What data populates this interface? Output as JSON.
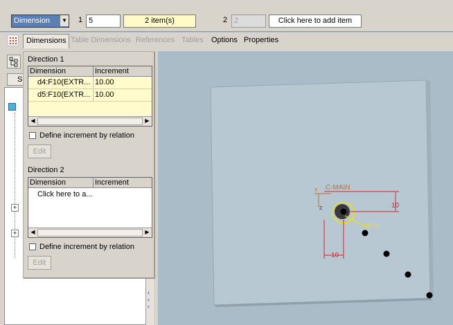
{
  "dashboard": {
    "dimension_select": "Dimension",
    "field1_label": "1",
    "field1_value": "5",
    "items_count": "2 item(s)",
    "field2_label": "2",
    "field2_value": "2",
    "add_item_prompt": "Click here to add item"
  },
  "tabs": [
    {
      "label": "Dimensions",
      "active": true,
      "enabled": true
    },
    {
      "label": "Table Dimensions",
      "active": false,
      "enabled": false
    },
    {
      "label": "References",
      "active": false,
      "enabled": false
    },
    {
      "label": "Tables",
      "active": false,
      "enabled": false
    },
    {
      "label": "Options",
      "active": false,
      "enabled": true
    },
    {
      "label": "Properties",
      "active": false,
      "enabled": true
    }
  ],
  "model_tree": {
    "header_letter": "S"
  },
  "direction1": {
    "title": "Direction 1",
    "col_dimension": "Dimension",
    "col_increment": "Increment",
    "rows": [
      {
        "dimension": "d4:F10(EXTR...",
        "increment": "10.00"
      },
      {
        "dimension": "d5:F10(EXTR...",
        "increment": "10.00"
      }
    ],
    "relation_checkbox": "Define increment by relation",
    "edit_button": "Edit"
  },
  "direction2": {
    "title": "Direction 2",
    "col_dimension": "Dimension",
    "col_increment": "Increment",
    "placeholder_row": "Click here to a...",
    "relation_checkbox": "Define increment by relation",
    "edit_button": "Edit"
  },
  "graphics": {
    "csys_label": "C-MAIN",
    "axis_x": "X",
    "axis_z": "Z",
    "dim_horizontal": "10",
    "dim_vertical": "10",
    "dim_diameter": "Ø10"
  },
  "colors": {
    "background": "#a9bcc8",
    "plate": "#b8c8d2",
    "dimension_red": "#e0202a",
    "highlight_yellow": "#f0e000",
    "csys_orange": "#c07020"
  }
}
